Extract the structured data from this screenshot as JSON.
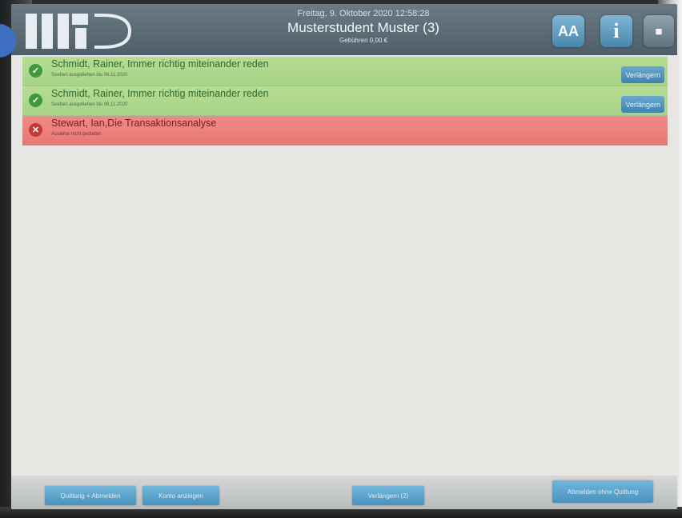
{
  "header": {
    "date": "Freitag, 9. Oktober 2020 12:58:28",
    "user": "Musterstudent Muster (3)",
    "fees": "Gebühren 0,00 €",
    "font_button": "AA",
    "info_button": "i"
  },
  "items": [
    {
      "status": "ok",
      "title": "Schmidt, Rainer, Immer richtig miteinander reden",
      "subtitle": "Soeben ausgeliehen bis 06.11.2020",
      "button": "Verlängern"
    },
    {
      "status": "ok",
      "title": "Schmidt, Rainer, Immer richtig miteinander reden",
      "subtitle": "Soeben ausgeliehen bis 06.11.2020",
      "button": "Verlängern"
    },
    {
      "status": "fail",
      "title": "Stewart, Ian,Die Transaktionsanalyse",
      "subtitle": "Ausleihe nicht gestattet"
    }
  ],
  "footer": {
    "receipt_logout": "Quittung + Abmelden",
    "show_account": "Konto anzeigen",
    "renew_all": "Verlängern (2)",
    "logout_no_receipt": "Abmelden ohne Quittung"
  },
  "colors": {
    "ok_row": "#b5dc94",
    "fail_row": "#ef8b88",
    "button": "#4b91bd",
    "header": "#5b6b75"
  }
}
